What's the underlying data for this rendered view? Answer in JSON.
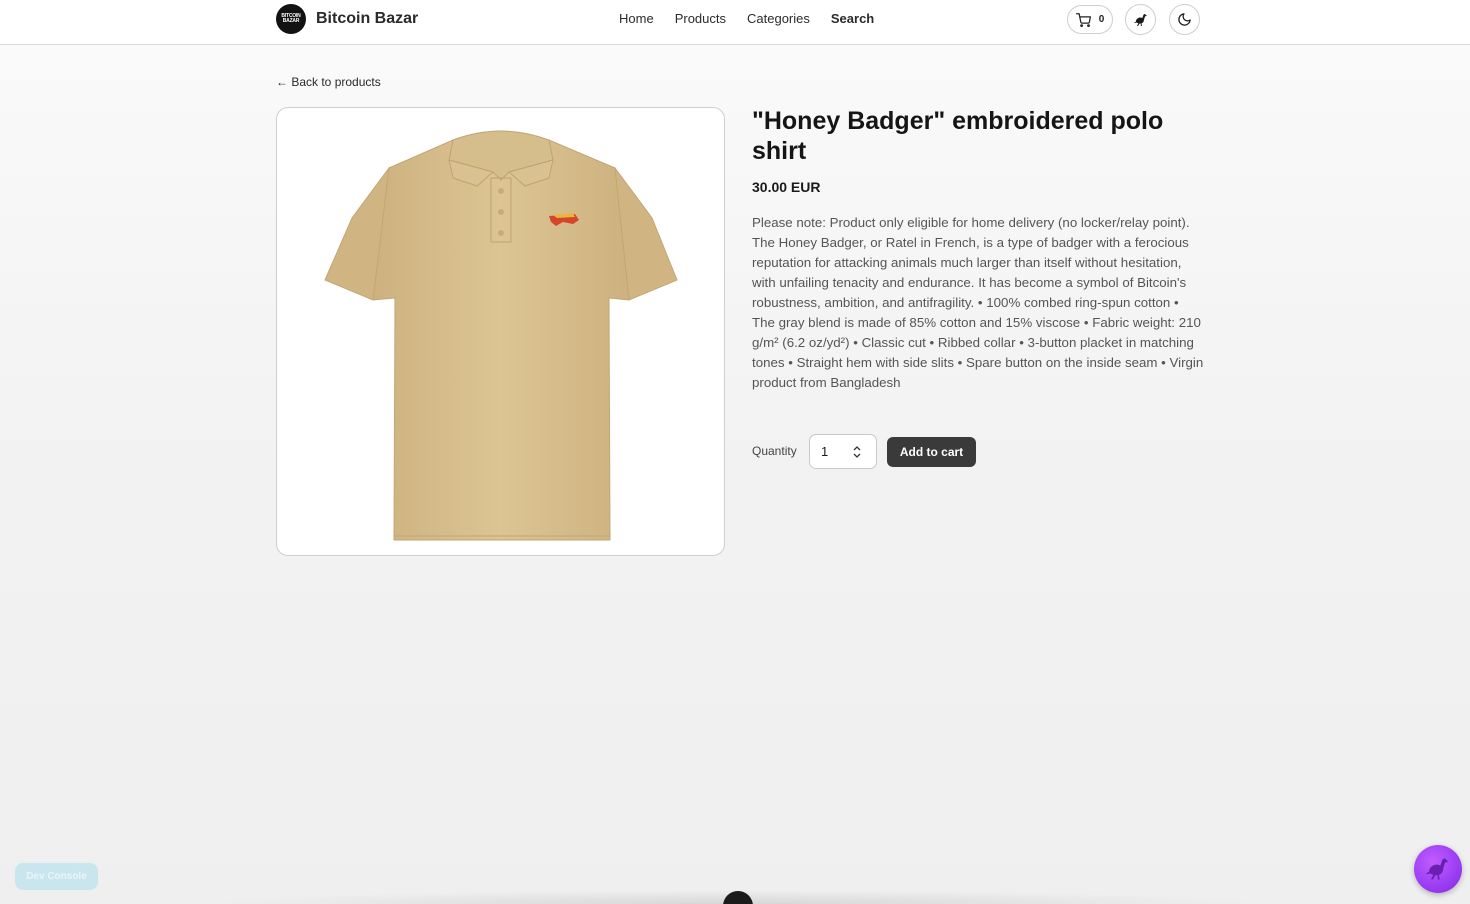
{
  "header": {
    "logo_text_top": "BITCOIN",
    "logo_text_bottom": "BAZAR",
    "brand_name": "Bitcoin Bazar",
    "nav": {
      "home": "Home",
      "products": "Products",
      "categories": "Categories",
      "search": "Search"
    },
    "cart_count": "0",
    "icons": {
      "cart": "shopping-cart-icon",
      "nostr": "ostrich-icon",
      "theme": "moon-icon"
    }
  },
  "main": {
    "back_label": "← Back to products",
    "product": {
      "title": "\"Honey Badger\" embroidered polo shirt",
      "price": "30.00 EUR",
      "description": "Please note: Product only eligible for home delivery (no locker/relay point). The Honey Badger, or Ratel in French, is a type of badger with a ferocious reputation for attacking animals much larger than itself without hesitation, with unfailing tenacity and endurance. It has become a symbol of Bitcoin's robustness, ambition, and antifragility. • 100% combed ring-spun cotton • The gray blend is made of 85% cotton and 15% viscose • Fabric weight: 210 g/m² (6.2 oz/yd²) • Classic cut • Ribbed collar • 3-button placket in matching tones • Straight hem with side slits • Spare button on the inside seam • Virgin product from Bangladesh",
      "shirt_color": "#d8bf8e",
      "embroidery_color": "#d4452a"
    },
    "quantity_label": "Quantity",
    "quantity_value": "1",
    "add_to_cart_label": "Add to cart"
  },
  "footer": {
    "dev_console_label": "Dev Console"
  },
  "colors": {
    "accent_dark": "#3a3a3a",
    "fab_purple": "#9a3df2",
    "dev_console_bg": "#c9e6ef"
  }
}
